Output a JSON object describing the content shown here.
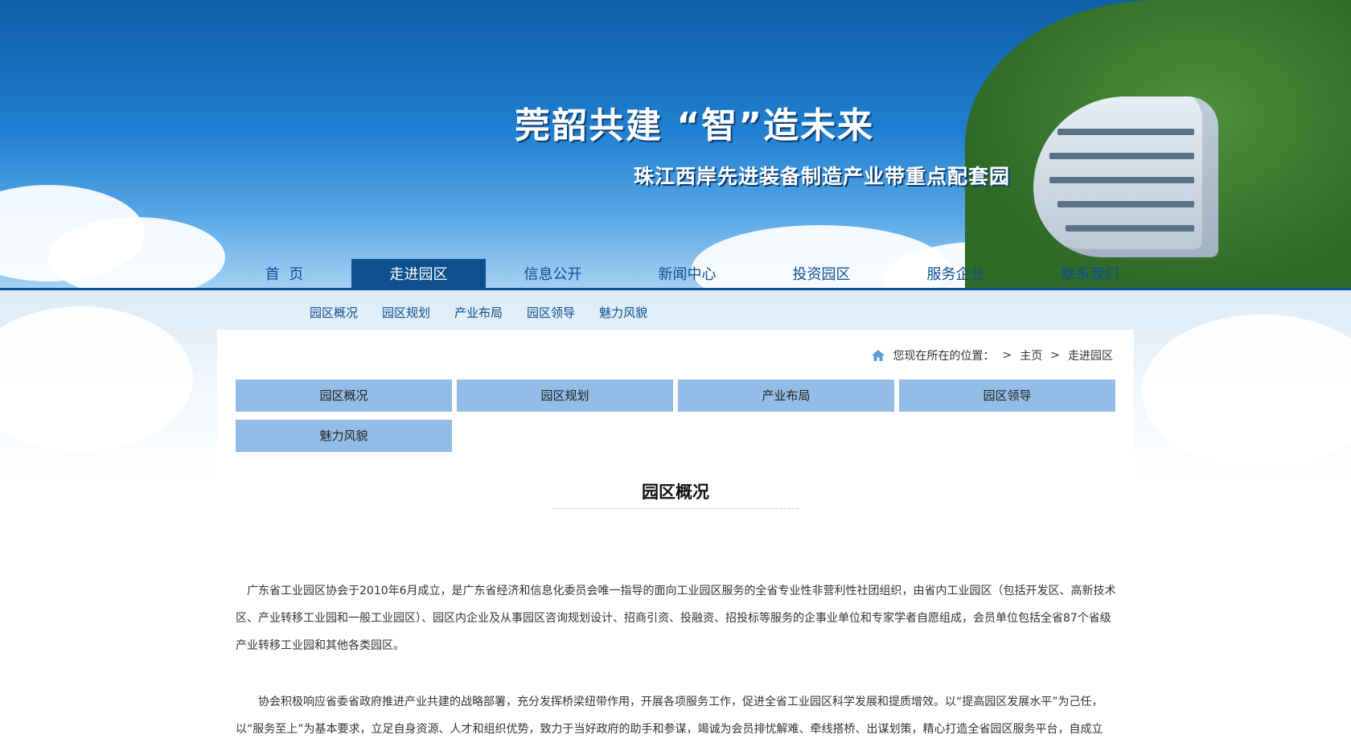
{
  "banner": {
    "slogan": "莞韶共建 “智”造未来",
    "sub_slogan": "珠江西岸先进装备制造产业带重点配套园"
  },
  "mainnav": {
    "items": [
      "首  页",
      "走进园区",
      "信息公开",
      "新闻中心",
      "投资园区",
      "服务企业",
      "联系我们"
    ],
    "active": "走进园区"
  },
  "subnav": {
    "items": [
      "园区概况",
      "园区规划",
      "产业布局",
      "园区领导",
      "魅力风貌"
    ]
  },
  "breadcrumb": {
    "label": "您现在所在的位置：",
    "sep": ">",
    "home": "主页",
    "current": "走进园区"
  },
  "tabs": [
    "园区概况",
    "园区规划",
    "产业布局",
    "园区领导",
    "魅力风貌"
  ],
  "article": {
    "title": "园区概况",
    "paragraphs": [
      "广东省工业园区协会于2010年6月成立，是广东省经济和信息化委员会唯一指导的面向工业园区服务的全省专业性非营利性社团组织，由省内工业园区（包括开发区、高新技术区、产业转移工业园和一般工业园区）、园区内企业及从事园区咨询规划设计、招商引资、投融资、招投标等服务的企事业单位和专家学者自愿组成，会员单位包括全省87个省级产业转移工业园和其他各类园区。",
      "协会积极响应省委省政府推进产业共建的战略部署，充分发挥桥梁纽带作用，开展各项服务工作，促进全省工业园区科学发展和提质增效。以“提高园区发展水平”为己任，以“服务至上”为基本要求，立足自身资源、人才和组织优势，致力于当好政府的助手和参谋，竭诚为会员排忧解难、牵线搭桥、出谋划策，精心打造全省园区服务平台，自成立"
    ]
  },
  "colors": {
    "nav_active": "#0e4f8e",
    "tab_bg": "#93bde6",
    "link": "#0d4e91"
  }
}
